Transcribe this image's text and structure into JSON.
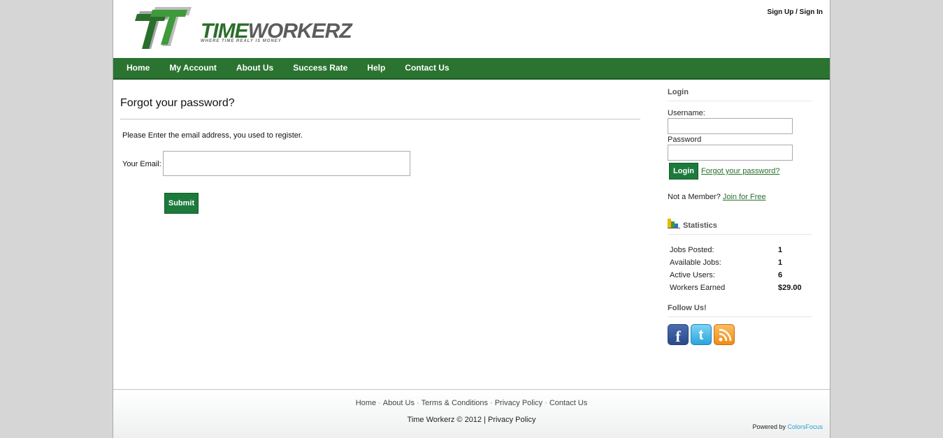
{
  "header": {
    "logo_time": "TIME",
    "logo_workerz": "WORKERZ",
    "tagline": "WHERE TIME REALY IS MONEY",
    "sign_up": "Sign Up",
    "sep": " / ",
    "sign_in": "Sign In"
  },
  "nav": {
    "items": [
      "Home",
      "My Account",
      "About Us",
      "Success Rate",
      "Help",
      "Contact Us"
    ]
  },
  "main": {
    "title": "Forgot your password?",
    "instruction": "Please Enter the email address, you used to register.",
    "email_label": "Your Email:",
    "email_value": "",
    "submit_label": "Submit"
  },
  "sidebar": {
    "login_heading": "Login",
    "username_label": "Username:",
    "password_label": "Password",
    "login_button": "Login",
    "forgot_link": "Forgot your password?",
    "not_member": "Not a Member? ",
    "join_link": "Join for Free",
    "stats_heading": "Statistics",
    "stats": [
      {
        "label": "Jobs Posted:",
        "value": "1"
      },
      {
        "label": "Available Jobs:",
        "value": "1"
      },
      {
        "label": "Active Users:",
        "value": "6"
      },
      {
        "label": "Workers Earned",
        "value": "$29.00"
      }
    ],
    "follow_heading": "Follow Us!",
    "social_icons": [
      "facebook-icon",
      "twitter-icon",
      "rss-icon"
    ]
  },
  "footer": {
    "links": [
      "Home",
      "About Us",
      "Terms & Conditions",
      "Privacy Policy",
      "Contact Us"
    ],
    "link_sep": "·",
    "copyright": "Time Workerz © 2012 | ",
    "privacy": "Privacy Policy",
    "powered_by": "Powered by ",
    "powered_link": "ColorsFocus"
  },
  "colors": {
    "nav_green": "#2a7331",
    "button_green": "#1c7a3b",
    "link_green": "#2a6e2b",
    "powered_blue": "#2a9fd6"
  }
}
